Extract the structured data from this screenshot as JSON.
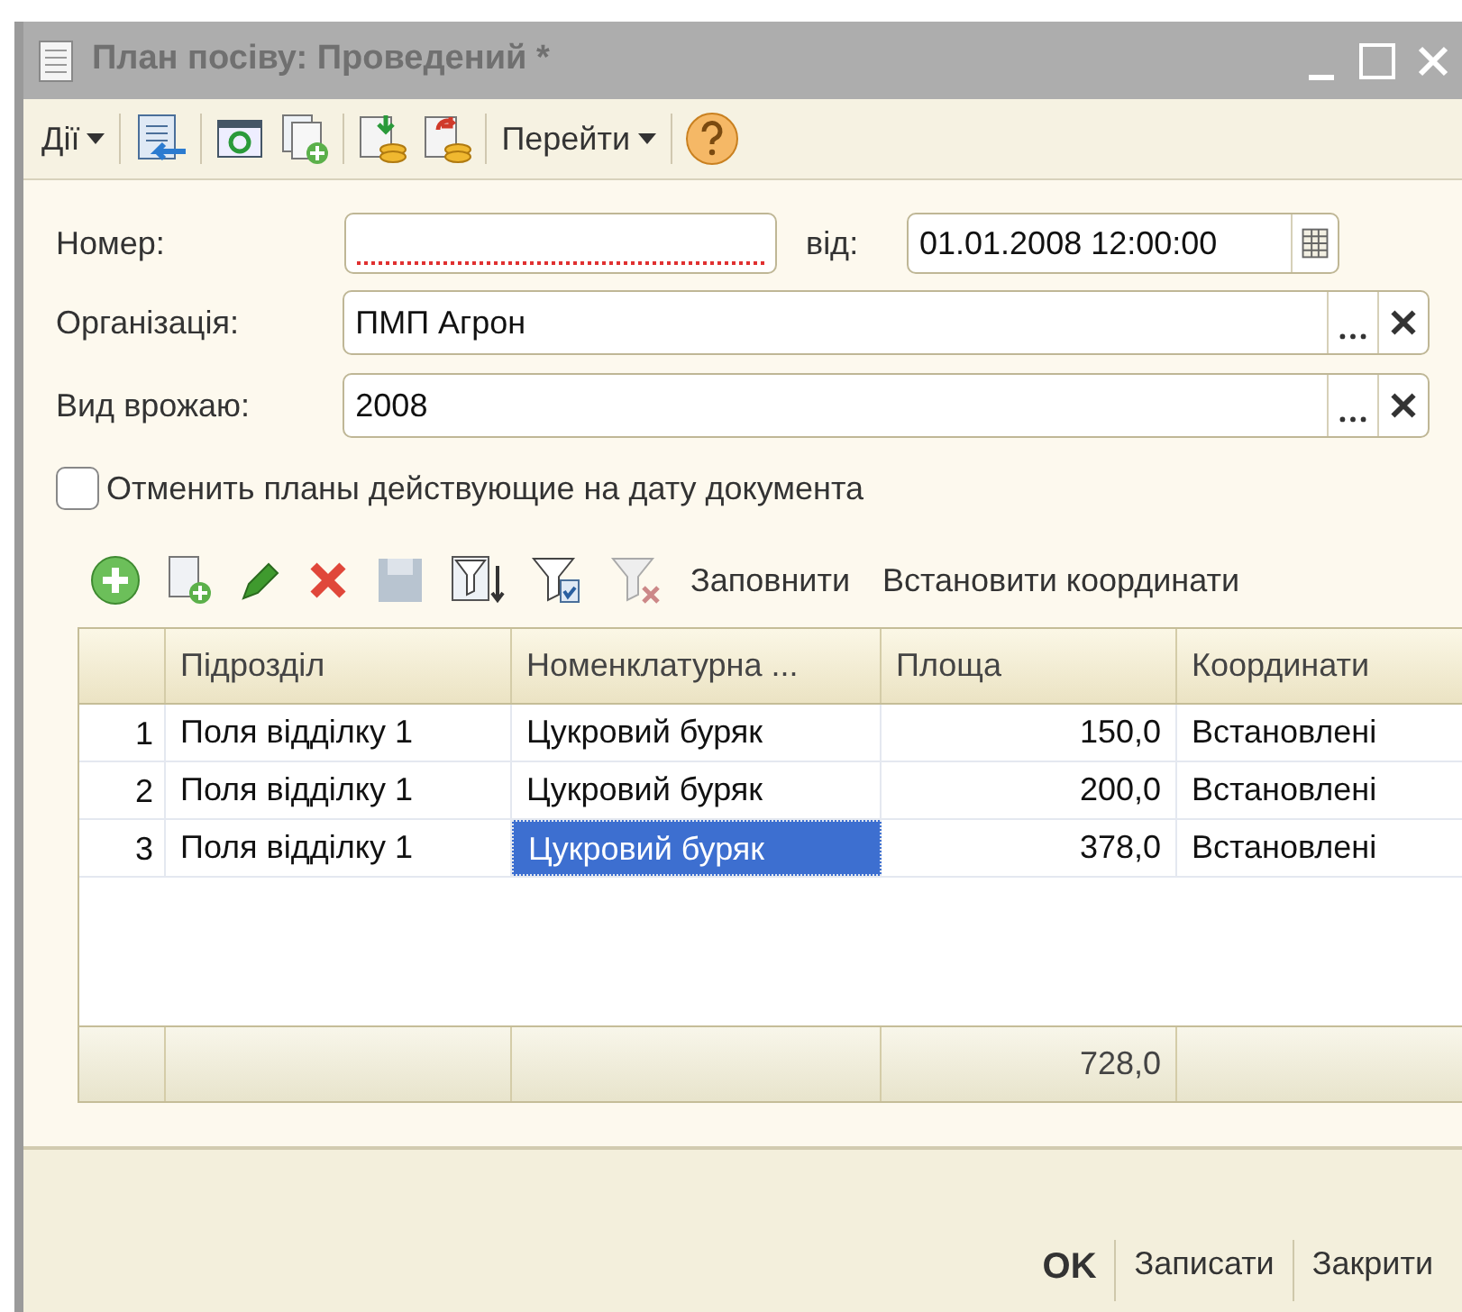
{
  "window": {
    "title": "План посіву: Проведений *"
  },
  "toolbar": {
    "actions_menu": "Дії",
    "goto_menu": "Перейти"
  },
  "number": {
    "label": "Номер:",
    "required": true
  },
  "date": {
    "label": "від:",
    "value": "01.01.2008 12:00:00"
  },
  "organization": {
    "label": "Організація:",
    "value": "ПМП Агрон"
  },
  "crop_type": {
    "label": "Вид врожаю:",
    "value": "2008"
  },
  "cancel_plans": {
    "label": "Отменить планы действующие на дату документа",
    "checked": false
  },
  "table_toolbar": {
    "buttons": [
      "Заповнити",
      "Встановити координати"
    ]
  },
  "table": {
    "columns": [
      "Підрозділ",
      "Номенклатурна ...",
      "Площа",
      "Координати"
    ],
    "rows": [
      {
        "n": "1",
        "cells": [
          "Поля відділку 1",
          "Цукровий буряк",
          "150,0",
          "Встановлені"
        ],
        "selected": false
      },
      {
        "n": "2",
        "cells": [
          "Поля відділку 1",
          "Цукровий буряк",
          "200,0",
          "Встановлені"
        ],
        "selected": false
      },
      {
        "n": "3",
        "cells": [
          "Поля відділку 1",
          "Цукровий буряк",
          "378,0",
          "Встановлені"
        ],
        "selected": true
      }
    ],
    "total_area": "728,0"
  },
  "footer_buttons": [
    {
      "label": "OK",
      "default": true
    },
    {
      "label": "Записати",
      "default": false
    },
    {
      "label": "Закрити",
      "default": false
    }
  ]
}
